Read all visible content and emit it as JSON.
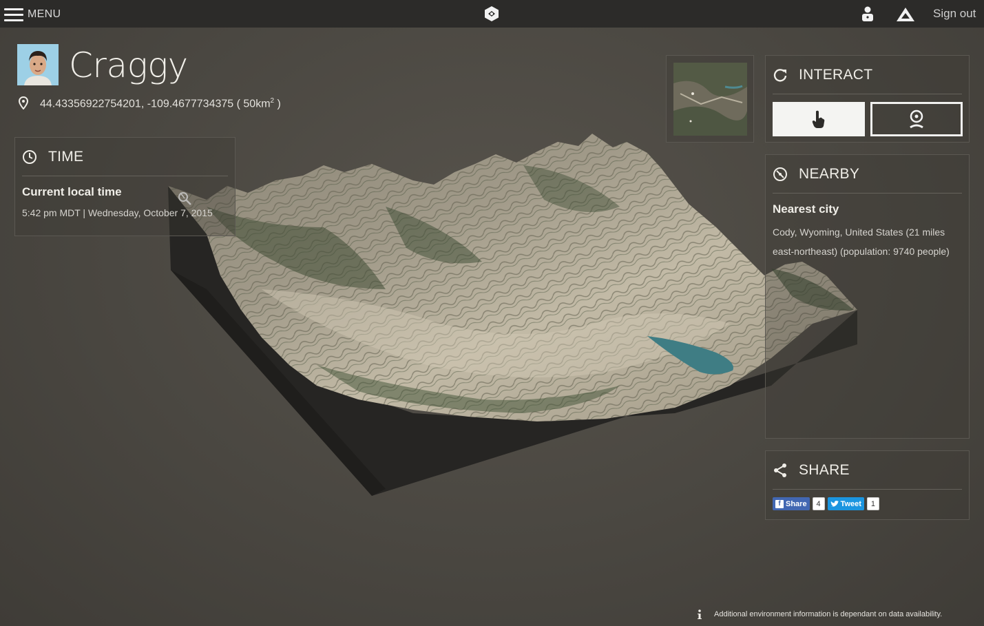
{
  "topbar": {
    "menu_label": "MENU",
    "sign_out": "Sign out",
    "icons": [
      "menu-icon",
      "logo-icon",
      "user-icon",
      "alert-icon"
    ]
  },
  "header": {
    "title": "Craggy",
    "coordinates": "44.43356922754201, -109.4677734375",
    "area": "50km",
    "area_exponent": "2"
  },
  "time": {
    "heading": "TIME",
    "subheading": "Current local time",
    "value": "5:42 pm MDT | Wednesday, October 7, 2015"
  },
  "interact": {
    "heading": "INTERACT",
    "modes": [
      "touch-mode",
      "view-mode"
    ],
    "active_mode": "touch-mode"
  },
  "nearby": {
    "heading": "NEARBY",
    "subheading": "Nearest city",
    "value": "Cody, Wyoming, United States (21 miles east-northeast) (population: 9740 people)"
  },
  "share": {
    "heading": "SHARE",
    "facebook_label": "Share",
    "facebook_count": "4",
    "twitter_label": "Tweet",
    "twitter_count": "1"
  },
  "footer": {
    "info": "Additional environment information is dependant on data availability."
  },
  "colors": {
    "background": "#4a4741",
    "topbar": "#2c2b29",
    "facebook": "#4267b2",
    "twitter": "#1b95e0"
  }
}
